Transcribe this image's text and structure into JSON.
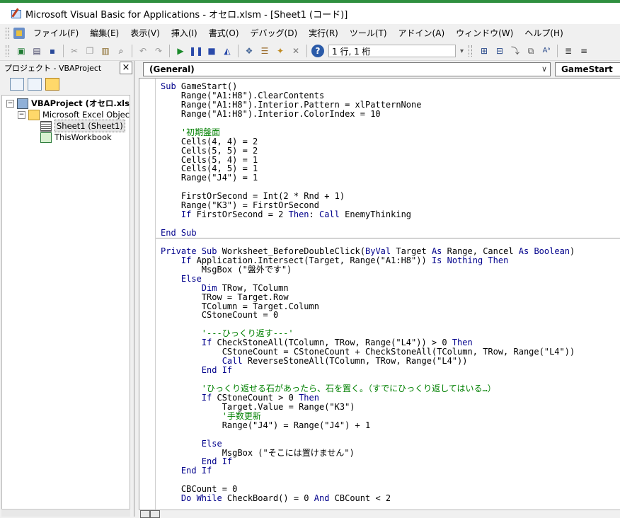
{
  "window": {
    "title": "Microsoft Visual Basic for Applications - オセロ.xlsm - [Sheet1 (コード)]"
  },
  "menu": [
    "ファイル(F)",
    "編集(E)",
    "表示(V)",
    "挿入(I)",
    "書式(O)",
    "デバッグ(D)",
    "実行(R)",
    "ツール(T)",
    "アドイン(A)",
    "ウィンドウ(W)",
    "ヘルプ(H)"
  ],
  "toolbar": {
    "position": "1 行, 1 桁",
    "icons": [
      "excel-view-icon",
      "insert-module-icon",
      "save-icon",
      "cut-icon",
      "copy-icon",
      "paste-icon",
      "find-icon",
      "undo-icon",
      "redo-icon",
      "run-icon",
      "break-icon",
      "reset-icon",
      "design-mode-icon",
      "project-explorer-icon",
      "properties-icon",
      "object-browser-icon",
      "toolbox-icon",
      "help-icon"
    ]
  },
  "project": {
    "title": "プロジェクト - VBAProject",
    "close": "×",
    "tree": [
      {
        "label": "VBAProject (オセロ.xls",
        "depth": 0,
        "expander": "−",
        "icon": "proj",
        "bold": true
      },
      {
        "label": "Microsoft Excel Objec",
        "depth": 1,
        "expander": "−",
        "icon": "folder"
      },
      {
        "label": "Sheet1 (Sheet1)",
        "depth": 2,
        "expander": "",
        "icon": "sheet",
        "selected": true
      },
      {
        "label": "ThisWorkbook",
        "depth": 2,
        "expander": "",
        "icon": "wb"
      }
    ]
  },
  "code": {
    "object": "(General)",
    "procedure": "GameStart",
    "lines": [
      [
        [
          "kw",
          "Sub "
        ],
        [
          "t",
          "GameStart()"
        ]
      ],
      [
        [
          "t",
          "    Range(\"A1:H8\").ClearContents"
        ]
      ],
      [
        [
          "t",
          "    Range(\"A1:H8\").Interior.Pattern = xlPatternNone"
        ]
      ],
      [
        [
          "t",
          "    Range(\"A1:H8\").Interior.ColorIndex = 10"
        ]
      ],
      [],
      [
        [
          "cm",
          "    '初期盤面"
        ]
      ],
      [
        [
          "t",
          "    Cells(4, 4) = 2"
        ]
      ],
      [
        [
          "t",
          "    Cells(5, 5) = 2"
        ]
      ],
      [
        [
          "t",
          "    Cells(5, 4) = 1"
        ]
      ],
      [
        [
          "t",
          "    Cells(4, 5) = 1"
        ]
      ],
      [
        [
          "t",
          "    Range(\"J4\") = 1"
        ]
      ],
      [],
      [
        [
          "t",
          "    FirstOrSecond = Int(2 * Rnd + 1)"
        ]
      ],
      [
        [
          "t",
          "    Range(\"K3\") = FirstOrSecond"
        ]
      ],
      [
        [
          "kw",
          "    If "
        ],
        [
          "t",
          "FirstOrSecond = 2 "
        ],
        [
          "kw",
          "Then"
        ],
        [
          "t",
          ": "
        ],
        [
          "kw",
          "Call "
        ],
        [
          "t",
          "EnemyThinking"
        ]
      ],
      [],
      [
        [
          "kw",
          "End Sub"
        ]
      ],
      [],
      [
        [
          "kw",
          "Private Sub "
        ],
        [
          "t",
          "Worksheet_BeforeDoubleClick("
        ],
        [
          "kw",
          "ByVal "
        ],
        [
          "t",
          "Target "
        ],
        [
          "kw",
          "As "
        ],
        [
          "t",
          "Range, Cancel "
        ],
        [
          "kw",
          "As Boolean"
        ],
        [
          "t",
          ")"
        ]
      ],
      [
        [
          "kw",
          "    If "
        ],
        [
          "t",
          "Application.Intersect(Target, Range(\"A1:H8\")) "
        ],
        [
          "kw",
          "Is Nothing Then"
        ]
      ],
      [
        [
          "t",
          "        MsgBox (\"盤外です\")"
        ]
      ],
      [
        [
          "kw",
          "    Else"
        ]
      ],
      [
        [
          "kw",
          "        Dim "
        ],
        [
          "t",
          "TRow, TColumn"
        ]
      ],
      [
        [
          "t",
          "        TRow = Target.Row"
        ]
      ],
      [
        [
          "t",
          "        TColumn = Target.Column"
        ]
      ],
      [
        [
          "t",
          "        CStoneCount = 0"
        ]
      ],
      [],
      [
        [
          "cm",
          "        '---ひっくり返す---'"
        ]
      ],
      [
        [
          "kw",
          "        If "
        ],
        [
          "t",
          "CheckStoneAll(TColumn, TRow, Range(\"L4\")) > 0 "
        ],
        [
          "kw",
          "Then"
        ]
      ],
      [
        [
          "t",
          "            CStoneCount = CStoneCount + CheckStoneAll(TColumn, TRow, Range(\"L4\"))"
        ]
      ],
      [
        [
          "kw",
          "            Call "
        ],
        [
          "t",
          "ReverseStoneAll(TColumn, TRow, Range(\"L4\"))"
        ]
      ],
      [
        [
          "kw",
          "        End If"
        ]
      ],
      [],
      [
        [
          "cm",
          "        'ひっくり返せる石があったら、石を置く。（すでにひっくり返してはいる…）"
        ]
      ],
      [
        [
          "kw",
          "        If "
        ],
        [
          "t",
          "CStoneCount > 0 "
        ],
        [
          "kw",
          "Then"
        ]
      ],
      [
        [
          "t",
          "            Target.Value = Range(\"K3\")"
        ]
      ],
      [
        [
          "cm",
          "            '手数更新"
        ]
      ],
      [
        [
          "t",
          "            Range(\"J4\") = Range(\"J4\") + 1"
        ]
      ],
      [],
      [
        [
          "kw",
          "        Else"
        ]
      ],
      [
        [
          "t",
          "            MsgBox (\"そこには置けません\")"
        ]
      ],
      [
        [
          "kw",
          "        End If"
        ]
      ],
      [
        [
          "kw",
          "    End If"
        ]
      ],
      [],
      [
        [
          "t",
          "    CBCount = 0"
        ]
      ],
      [
        [
          "kw",
          "    Do While "
        ],
        [
          "t",
          "CheckBoard() = 0 "
        ],
        [
          "kw",
          "And "
        ],
        [
          "t",
          "CBCount < 2"
        ]
      ]
    ]
  }
}
